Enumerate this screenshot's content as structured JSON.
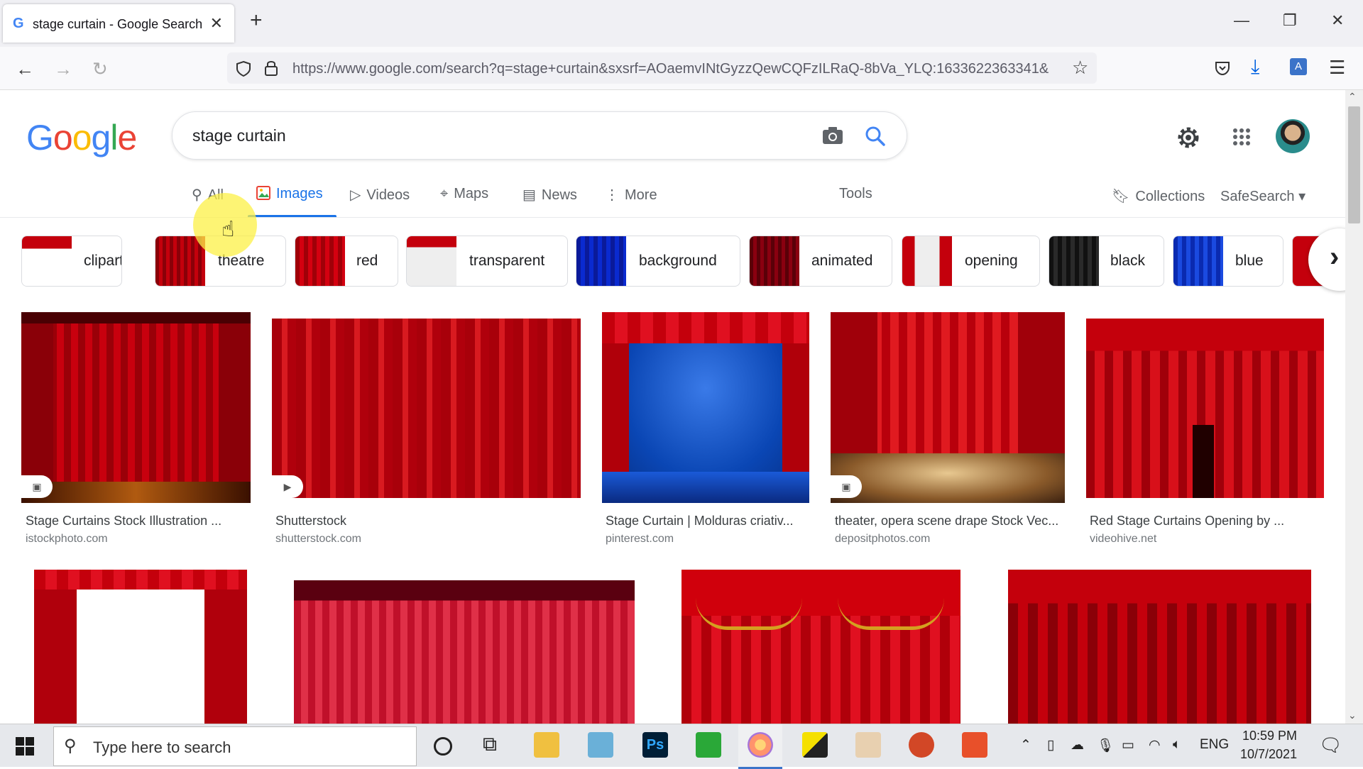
{
  "browser": {
    "tab_title": "stage curtain - Google Search",
    "url": "https://www.google.com/search?q=stage+curtain&sxsrf=AOaemvINtGyzzQewCQFzILRaQ-8bVa_YLQ:1633622363341&"
  },
  "google": {
    "query": "stage curtain",
    "tabs": {
      "all": "All",
      "images": "Images",
      "videos": "Videos",
      "maps": "Maps",
      "news": "News",
      "more": "More",
      "tools": "Tools"
    },
    "collections": "Collections",
    "safesearch": "SafeSearch",
    "chips": [
      "clipart",
      "theatre",
      "red",
      "transparent",
      "background",
      "animated",
      "opening",
      "black",
      "blue"
    ]
  },
  "results": [
    {
      "title": "Stage Curtains Stock Illustration ...",
      "source": "istockphoto.com"
    },
    {
      "title": "Shutterstock",
      "source": "shutterstock.com"
    },
    {
      "title": "Stage Curtain | Molduras criativ...",
      "source": "pinterest.com"
    },
    {
      "title": "theater, opera scene drape Stock Vec...",
      "source": "depositphotos.com"
    },
    {
      "title": "Red Stage Curtains Opening by ...",
      "source": "videohive.net"
    }
  ],
  "taskbar": {
    "search_placeholder": "Type here to search",
    "language": "ENG",
    "time": "10:59 PM",
    "date": "10/7/2021"
  },
  "colors": {
    "accent": "#1a73e8",
    "curtain_red": "#c4000c",
    "stage_blue": "#0a46b4"
  }
}
